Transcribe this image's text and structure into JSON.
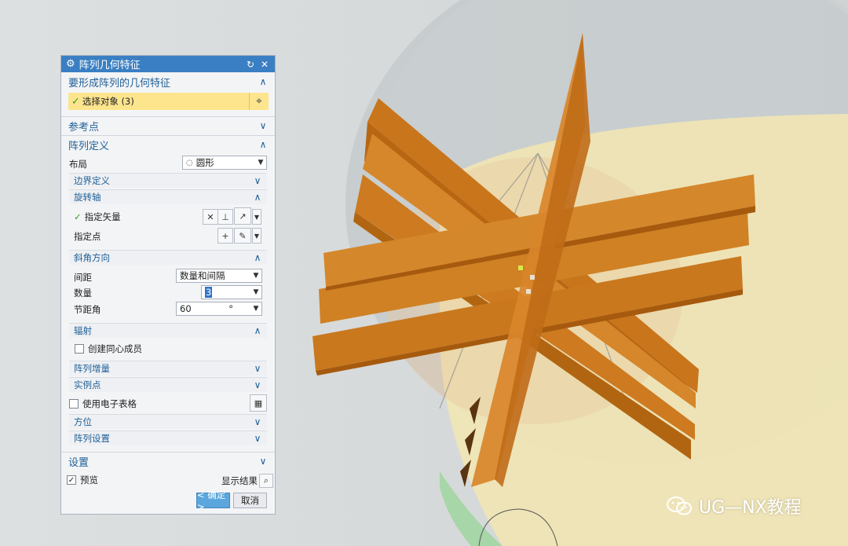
{
  "dialog": {
    "title": "阵列几何特征",
    "section_geometry": "要形成阵列的几何特征",
    "select_object": "选择对象 (3)",
    "section_ref_point": "参考点",
    "section_pattern_def": "阵列定义",
    "layout_label": "布局",
    "layout_value": "圆形",
    "boundary_def": "边界定义",
    "rotation_axis": "旋转轴",
    "specify_vector": "指定矢量",
    "specify_point": "指定点",
    "angular_direction": "斜角方向",
    "spacing_label": "间距",
    "spacing_value": "数量和间隔",
    "count_label": "数量",
    "count_value": "3",
    "pitch_angle_label": "节距角",
    "pitch_angle_value": "60",
    "pitch_angle_unit": "°",
    "radiation": "辐射",
    "create_concentric": "创建同心成员",
    "pattern_increment": "阵列增量",
    "instance_point": "实例点",
    "use_spreadsheet": "使用电子表格",
    "orientation": "方位",
    "pattern_settings": "阵列设置",
    "section_settings": "设置",
    "preview": "预览",
    "show_result": "显示结果",
    "ok": "< 确定 >",
    "cancel": "取消"
  },
  "watermark": {
    "text": "UG—NX教程"
  },
  "colors": {
    "accent": "#3a7fc3",
    "selected_row": "#fde58e",
    "model": "#d9821f"
  }
}
